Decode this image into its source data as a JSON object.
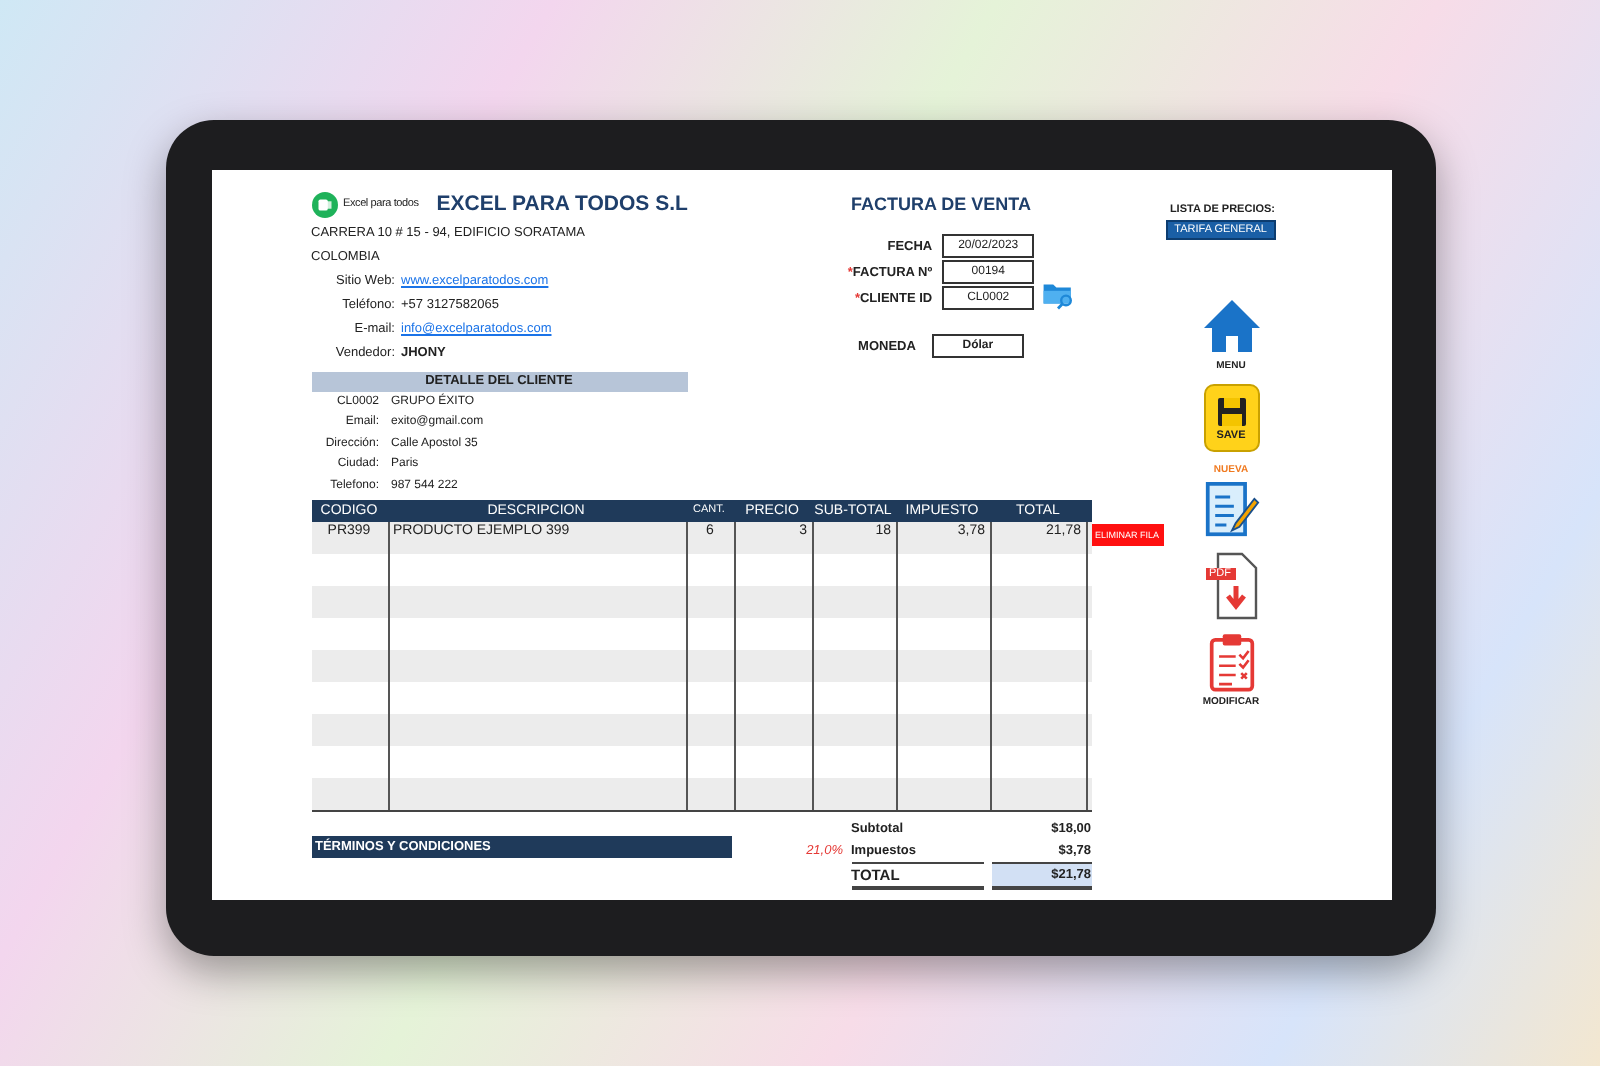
{
  "company": {
    "logo_text": "Excel para todos",
    "name": "EXCEL PARA TODOS S.L",
    "address": "CARRERA 10 # 15 - 94, EDIFICIO SORATAMA",
    "country": "COLOMBIA",
    "fields": [
      {
        "label": "Sitio Web:",
        "value": "www.excelparatodos.com",
        "kind": "link"
      },
      {
        "label": "Teléfono:",
        "value": "+57 3127582065",
        "kind": "text"
      },
      {
        "label": "E-mail:",
        "value": "info@excelparatodos.com",
        "kind": "link"
      },
      {
        "label": "Vendedor:",
        "value": "JHONY",
        "kind": "bold"
      }
    ]
  },
  "client": {
    "title": "DETALLE DEL CLIENTE",
    "rows": [
      {
        "label": "CL0002",
        "value": "GRUPO ÉXITO"
      },
      {
        "label": "Email:",
        "value": "exito@gmail.com"
      },
      {
        "label": "Dirección:",
        "value": "Calle Apostol 35"
      },
      {
        "label": "Ciudad:",
        "value": "Paris"
      },
      {
        "label": "Telefono:",
        "value": "987 544 222"
      }
    ]
  },
  "invoice": {
    "title": "FACTURA DE VENTA",
    "fields": [
      {
        "label": "FECHA",
        "value": "20/02/2023"
      },
      {
        "label": "FACTURA Nº",
        "required_mark": "*",
        "value": "00194"
      },
      {
        "label": "CLIENTE ID",
        "required_mark": "*",
        "value": "CL0002"
      }
    ],
    "currency": {
      "label": "MONEDA",
      "value": "Dólar"
    }
  },
  "price_list": {
    "label": "LISTA DE PRECIOS:",
    "value": "TARIFA GENERAL"
  },
  "table": {
    "columns": [
      "CODIGO",
      "DESCRIPCION",
      "CANT.",
      "PRECIO",
      "SUB-TOTAL",
      "IMPUESTO",
      "TOTAL"
    ],
    "rows": [
      [
        "PR399",
        "PRODUCTO EJEMPLO 399",
        "6",
        "3",
        "18",
        "3,78",
        "21,78"
      ]
    ]
  },
  "delete_button": "ELIMINAR FILA",
  "terms": {
    "title": "TÉRMINOS Y CONDICIONES"
  },
  "totals": [
    {
      "label": "Subtotal",
      "value": "$18,00",
      "kind": "plain"
    },
    {
      "label": "Impuestos",
      "value": "$3,78",
      "rate": "21,0%",
      "kind": "plain"
    },
    {
      "label": "TOTAL",
      "value": "$21,78",
      "kind": "grand"
    }
  ],
  "actions": [
    {
      "kind": "menu",
      "label": "MENU"
    },
    {
      "kind": "save",
      "label": "SAVE"
    },
    {
      "kind": "new",
      "label": "NUEVA"
    },
    {
      "kind": "pdf",
      "label": "PDF"
    },
    {
      "kind": "edit",
      "label": "MODIFICAR"
    }
  ]
}
